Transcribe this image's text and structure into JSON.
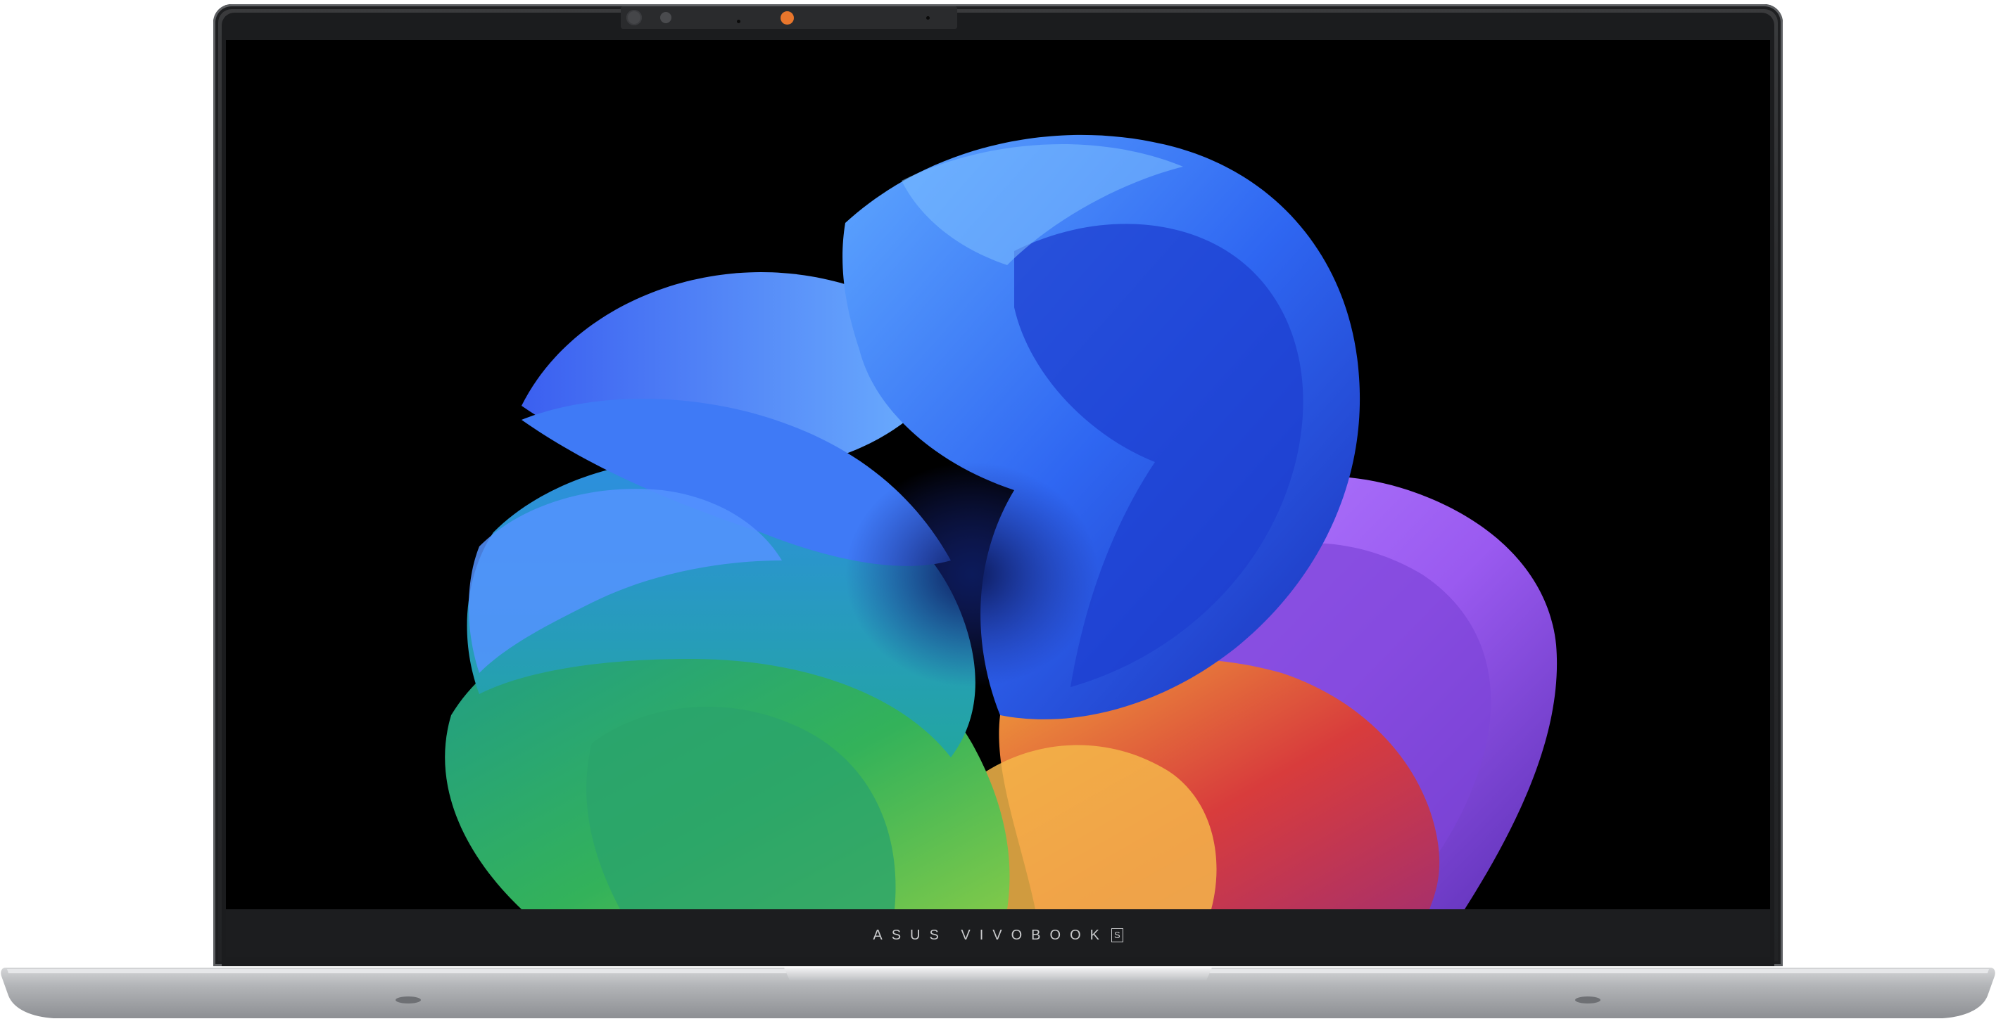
{
  "device": {
    "brand_text": "ASUS VIVOBOOK",
    "brand_mark": "S"
  },
  "colors": {
    "lid": "#2b2c2e",
    "bezel": "#1b1c1e",
    "screen_background": "#000000",
    "chassis": "#a9abae",
    "camera_indicator": "#e8762c",
    "wallpaper_blue": "#2f67f2",
    "wallpaper_teal": "#22a6a0",
    "wallpaper_green": "#33b25a",
    "wallpaper_orange": "#f0a23a",
    "wallpaper_red": "#d83c3c",
    "wallpaper_purple": "#9a5af0"
  },
  "icons": {
    "camera_shutter": "camera-shutter-icon",
    "camera_lens": "camera-lens-icon",
    "camera_indicator": "camera-indicator-icon",
    "sensor": "sensor-dot-icon"
  }
}
